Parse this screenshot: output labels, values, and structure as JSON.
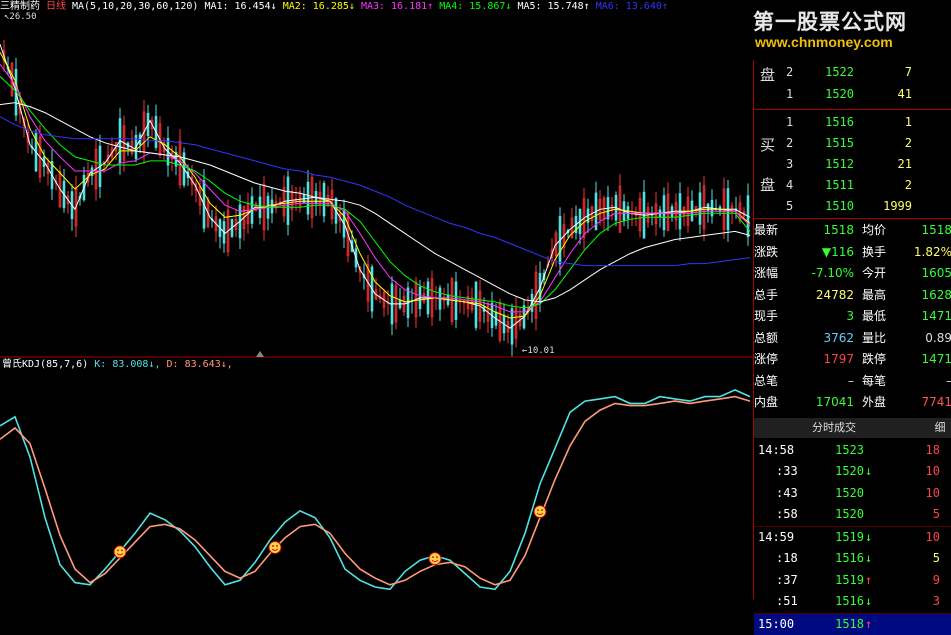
{
  "header": {
    "stock_name": "三精制药",
    "period": "日线",
    "ma_params": "MA(5,10,20,30,60,120)",
    "ma_values": [
      {
        "label": "MA1:",
        "value": "16.454↓",
        "color": "#ffffff"
      },
      {
        "label": "MA2:",
        "value": "16.285↓",
        "color": "#ffff00"
      },
      {
        "label": "MA3:",
        "value": "16.181↑",
        "color": "#ff33ff"
      },
      {
        "label": "MA4:",
        "value": "15.867↓",
        "color": "#00ff00"
      },
      {
        "label": "MA5:",
        "value": "15.748↑",
        "color": "#ffffff"
      },
      {
        "label": "MA6:",
        "value": "13.640↑",
        "color": "#3333ff"
      }
    ],
    "price_high_label": "26.50",
    "price_low_label": "10.01"
  },
  "watermark": {
    "line1": "第一股票公式网",
    "line2": "www.chnmoney.com"
  },
  "indicator": {
    "name": "曾氏KDJ(85,7,6)",
    "k_label": "K: 83.008↓,",
    "d_label": "D: 83.643↓,",
    "k_color": "#4fe3e3",
    "d_color": "#ff9a7a"
  },
  "chart_data": [
    {
      "type": "line",
      "title": "日线 K线 + MA(5,10,20,30,60,120)",
      "ylim": [
        10.01,
        26.5
      ],
      "x": [
        0,
        15,
        30,
        45,
        60,
        75,
        90,
        105,
        120,
        135,
        150,
        165,
        180,
        195,
        210,
        225,
        240,
        255,
        270,
        285,
        300,
        315,
        330,
        345,
        360,
        375,
        390,
        405,
        420,
        435,
        450,
        465,
        480,
        495,
        510,
        525,
        540,
        555,
        570,
        585,
        600,
        615,
        630,
        645,
        660,
        675,
        690,
        705,
        720,
        735,
        750
      ],
      "series": [
        {
          "name": "MA1",
          "color": "#ffffff",
          "values": [
            25.2,
            23.0,
            20.2,
            19.3,
            18.0,
            17.0,
            18.8,
            19.3,
            20.4,
            20.0,
            21.4,
            20.0,
            19.3,
            18.2,
            16.6,
            15.8,
            16.4,
            17.1,
            17.1,
            17.4,
            17.5,
            17.6,
            17.4,
            16.2,
            14.0,
            12.8,
            12.3,
            12.3,
            12.6,
            12.6,
            12.5,
            12.4,
            12.2,
            11.6,
            11.1,
            11.7,
            13.1,
            15.2,
            16.0,
            16.6,
            17.0,
            17.1,
            16.8,
            16.7,
            16.8,
            16.9,
            16.9,
            17.1,
            17.0,
            17.0,
            16.6
          ]
        },
        {
          "name": "MA2",
          "color": "#ffff00",
          "values": [
            24.8,
            23.4,
            21.0,
            19.6,
            18.8,
            18.0,
            18.7,
            19.0,
            19.9,
            19.9,
            20.6,
            20.2,
            19.6,
            18.6,
            17.3,
            16.6,
            16.7,
            17.0,
            17.2,
            17.3,
            17.4,
            17.4,
            17.4,
            16.6,
            14.8,
            13.4,
            12.7,
            12.4,
            12.5,
            12.6,
            12.5,
            12.4,
            12.3,
            11.9,
            11.6,
            11.7,
            12.7,
            14.5,
            15.7,
            16.4,
            16.8,
            17.0,
            16.9,
            16.8,
            16.8,
            16.8,
            16.9,
            17.0,
            17.0,
            16.9,
            16.3
          ]
        },
        {
          "name": "MA3",
          "color": "#ff33ff",
          "values": [
            24.2,
            23.2,
            21.6,
            20.4,
            19.6,
            18.9,
            18.9,
            18.9,
            19.3,
            19.4,
            19.8,
            19.7,
            19.4,
            18.8,
            18.0,
            17.2,
            16.9,
            17.0,
            17.1,
            17.2,
            17.3,
            17.3,
            17.3,
            16.9,
            15.8,
            14.6,
            13.6,
            13.0,
            12.7,
            12.6,
            12.6,
            12.5,
            12.4,
            12.2,
            11.9,
            11.9,
            12.4,
            13.6,
            14.8,
            15.8,
            16.4,
            16.8,
            16.8,
            16.8,
            16.8,
            16.8,
            16.8,
            16.9,
            16.9,
            16.9,
            16.2
          ]
        },
        {
          "name": "MA4",
          "color": "#00ff00",
          "values": [
            23.6,
            22.9,
            21.9,
            21.0,
            20.2,
            19.6,
            19.4,
            19.2,
            19.2,
            19.2,
            19.4,
            19.4,
            19.2,
            18.9,
            18.4,
            17.8,
            17.4,
            17.2,
            17.1,
            17.1,
            17.1,
            17.2,
            17.2,
            17.0,
            16.4,
            15.4,
            14.4,
            13.7,
            13.2,
            12.9,
            12.7,
            12.6,
            12.5,
            12.4,
            12.2,
            12.1,
            12.3,
            13.0,
            14.0,
            15.0,
            15.8,
            16.3,
            16.5,
            16.6,
            16.6,
            16.6,
            16.7,
            16.8,
            16.8,
            16.8,
            15.9
          ]
        },
        {
          "name": "MA5",
          "color": "#ffffff",
          "values": [
            22.2,
            22.3,
            22.1,
            21.8,
            21.4,
            21.0,
            20.6,
            20.3,
            20.1,
            19.9,
            19.8,
            19.7,
            19.6,
            19.4,
            19.2,
            18.9,
            18.6,
            18.3,
            18.1,
            17.9,
            17.8,
            17.6,
            17.5,
            17.4,
            17.2,
            16.8,
            16.3,
            15.8,
            15.3,
            14.8,
            14.4,
            14.0,
            13.6,
            13.2,
            12.8,
            12.5,
            12.4,
            12.6,
            13.0,
            13.5,
            14.0,
            14.4,
            14.8,
            15.1,
            15.3,
            15.5,
            15.6,
            15.7,
            15.8,
            15.9,
            15.7
          ]
        },
        {
          "name": "MA6",
          "color": "#3333ff",
          "values": [
            21.6,
            21.2,
            20.9,
            20.7,
            20.6,
            20.5,
            20.5,
            20.5,
            20.5,
            20.5,
            20.4,
            20.4,
            20.3,
            20.2,
            20.0,
            19.8,
            19.6,
            19.4,
            19.2,
            19.0,
            18.9,
            18.7,
            18.6,
            18.4,
            18.2,
            17.9,
            17.6,
            17.2,
            16.9,
            16.6,
            16.3,
            16.1,
            15.8,
            15.6,
            15.3,
            15.0,
            14.7,
            14.4,
            14.3,
            14.2,
            14.2,
            14.2,
            14.2,
            14.2,
            14.2,
            14.2,
            14.3,
            14.3,
            14.4,
            14.5,
            14.6
          ]
        }
      ]
    },
    {
      "type": "line",
      "title": "曾氏KDJ(85,7,6)",
      "ylim": [
        0,
        100
      ],
      "x": [
        0,
        15,
        30,
        45,
        60,
        75,
        90,
        105,
        120,
        135,
        150,
        165,
        180,
        195,
        210,
        225,
        240,
        255,
        270,
        285,
        300,
        315,
        330,
        345,
        360,
        375,
        390,
        405,
        420,
        435,
        450,
        465,
        480,
        495,
        510,
        525,
        540,
        555,
        570,
        585,
        600,
        615,
        630,
        645,
        660,
        675,
        690,
        705,
        720,
        735,
        750
      ],
      "series": [
        {
          "name": "K",
          "color": "#4fe3e3",
          "values": [
            76,
            80,
            62,
            35,
            14,
            6,
            5,
            12,
            20,
            28,
            37,
            34,
            29,
            22,
            13,
            5,
            7,
            15,
            25,
            33,
            38,
            35,
            26,
            12,
            7,
            4,
            3,
            11,
            16,
            18,
            16,
            10,
            4,
            3,
            11,
            28,
            50,
            66,
            82,
            87,
            88,
            89,
            86,
            86,
            89,
            88,
            87,
            89,
            89,
            92,
            89
          ]
        },
        {
          "name": "D",
          "color": "#ff9a7a",
          "values": [
            70,
            75,
            68,
            48,
            27,
            12,
            6,
            10,
            17,
            24,
            31,
            32,
            30,
            25,
            18,
            11,
            8,
            11,
            19,
            26,
            31,
            32,
            28,
            19,
            12,
            8,
            5,
            7,
            11,
            14,
            15,
            13,
            8,
            5,
            7,
            18,
            35,
            52,
            67,
            78,
            83,
            86,
            85,
            85,
            86,
            87,
            86,
            87,
            88,
            89,
            87
          ]
        }
      ],
      "markers_x": [
        120,
        275,
        435,
        540
      ]
    }
  ],
  "panel": {
    "bid_ask_label_top": "盘",
    "ask_rows": [
      {
        "idx": "2",
        "price": "1522",
        "vol": "7"
      },
      {
        "idx": "1",
        "price": "1520",
        "vol": "41"
      }
    ],
    "buy_label_1": "买",
    "buy_label_2": "盘",
    "bid_rows": [
      {
        "idx": "1",
        "price": "1516",
        "vol": "1"
      },
      {
        "idx": "2",
        "price": "1515",
        "vol": "2"
      },
      {
        "idx": "3",
        "price": "1512",
        "vol": "21"
      },
      {
        "idx": "4",
        "price": "1511",
        "vol": "2"
      },
      {
        "idx": "5",
        "price": "1510",
        "vol": "1999"
      }
    ],
    "stats": [
      {
        "l1": "最新",
        "v1": "1518",
        "l1c": "#ffffff",
        "v1c": "#33ff33",
        "l2": "均价",
        "v2": "1518",
        "v2c": "#33ff33"
      },
      {
        "l1": "涨跌",
        "v1": "▼116",
        "l1c": "#ffffff",
        "v1c": "#33ff33",
        "l2": "换手",
        "v2": "1.82%",
        "v2c": "#ffff66"
      },
      {
        "l1": "涨幅",
        "v1": "-7.10%",
        "l1c": "#ffffff",
        "v1c": "#33ff33",
        "l2": "今开",
        "v2": "1605",
        "v2c": "#33ff33"
      },
      {
        "l1": "总手",
        "v1": "24782",
        "l1c": "#ffffff",
        "v1c": "#ffff66",
        "l2": "最高",
        "v2": "1628",
        "v2c": "#33ff33"
      },
      {
        "l1": "现手",
        "v1": "3",
        "l1c": "#ffffff",
        "v1c": "#33ff33",
        "l2": "最低",
        "v2": "1471",
        "v2c": "#33ff33"
      },
      {
        "l1": "总额",
        "v1": "3762",
        "l1c": "#ffffff",
        "v1c": "#66ccff",
        "l2": "量比",
        "v2": "0.89",
        "v2c": "#dddddd"
      },
      {
        "l1": "涨停",
        "v1": "1797",
        "l1c": "#ffffff",
        "v1c": "#ff4444",
        "l2": "跌停",
        "v2": "1471",
        "v2c": "#33ff33"
      },
      {
        "l1": "总笔",
        "v1": "–",
        "l1c": "#ffffff",
        "v1c": "#dddddd",
        "l2": "每笔",
        "v2": "–",
        "v2c": "#dddddd"
      },
      {
        "l1": "内盘",
        "v1": "17041",
        "l1c": "#ffffff",
        "v1c": "#33ff33",
        "l2": "外盘",
        "v2": "7741",
        "v2c": "#ff5555"
      }
    ],
    "trades_tab": "分时成交",
    "trades_tab2": "细",
    "trades": [
      {
        "time": "14:58",
        "price": "1523",
        "arrow": "",
        "vol": "18",
        "vc": "#ff4444"
      },
      {
        "time": ":33",
        "price": "1520",
        "arrow": "↓",
        "vol": "10",
        "vc": "#ff4444"
      },
      {
        "time": ":43",
        "price": "1520",
        "arrow": "",
        "vol": "10",
        "vc": "#ff4444"
      },
      {
        "time": ":58",
        "price": "1520",
        "arrow": "",
        "vol": "5",
        "vc": "#ff4444"
      },
      {
        "time": "14:59",
        "price": "1519",
        "arrow": "↓",
        "vol": "10",
        "vc": "#ff4444"
      },
      {
        "time": ":18",
        "price": "1516",
        "arrow": "↓",
        "vol": "5",
        "vc": "#ffff66"
      },
      {
        "time": ":37",
        "price": "1519",
        "arrow": "↑",
        "vol": "9",
        "vc": "#ff4444"
      },
      {
        "time": ":51",
        "price": "1516",
        "arrow": "↓",
        "vol": "3",
        "vc": "#ff4444"
      },
      {
        "time": "15:00",
        "price": "1518",
        "arrow": "↑",
        "vol": "",
        "vc": "#ff4444"
      }
    ]
  }
}
